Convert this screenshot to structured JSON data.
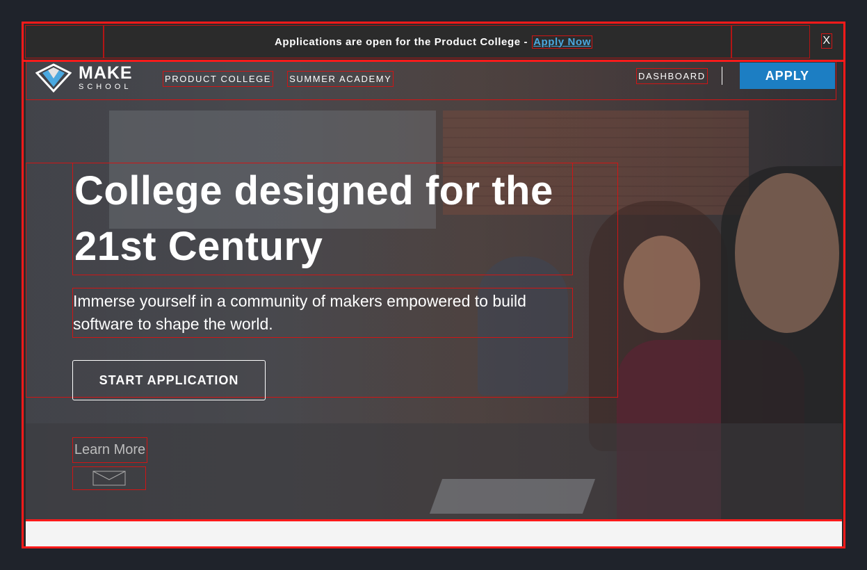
{
  "announcement": {
    "text": "Applications are open for the Product College -",
    "link_label": "Apply Now",
    "close_label": "X"
  },
  "nav": {
    "logo_make": "MAKE",
    "logo_school": "SCHOOL",
    "links": [
      "PRODUCT COLLEGE",
      "SUMMER ACADEMY"
    ],
    "dashboard_label": "DASHBOARD",
    "apply_label": "APPLY"
  },
  "hero": {
    "headline": "College designed for the 21st Century",
    "subtext": "Immerse yourself in a community of makers empowered to build software to shape the world.",
    "cta_label": "START APPLICATION",
    "learn_more": "Learn More"
  },
  "colors": {
    "accent": "#1c7ec3",
    "link": "#4aa8e0",
    "outline": "#ff1a1a"
  },
  "icons": {
    "logo": "make-school-logo-icon",
    "scroll": "envelope-chevron-down-icon",
    "close": "close-icon"
  }
}
